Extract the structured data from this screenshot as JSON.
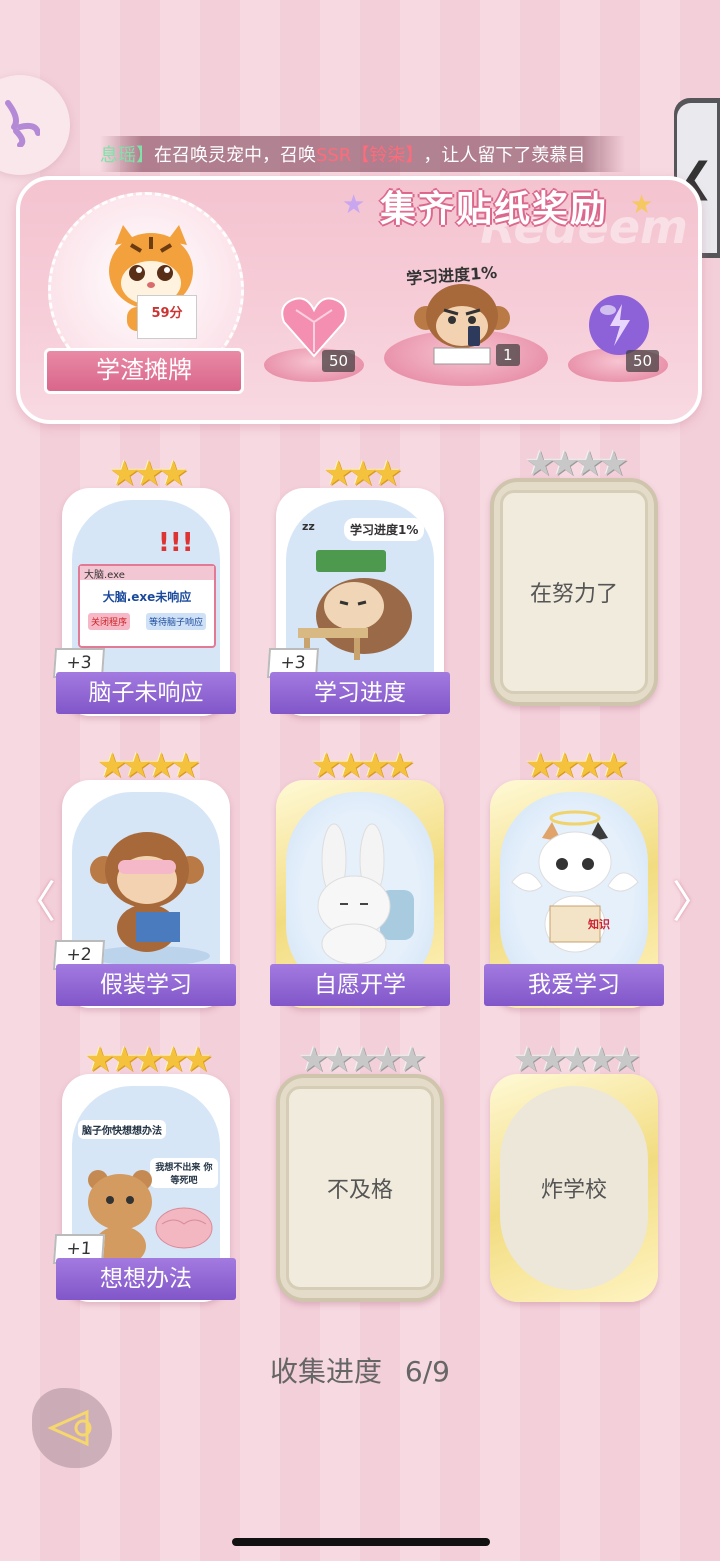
{
  "marquee": {
    "prefix": "息瑶】",
    "mid1": "在召唤灵宠中，召唤",
    "ssr": "SSR【铃柒】",
    "mid2": "，让人留下了羡慕目"
  },
  "side_tab": {
    "icon": "chevron-left-icon",
    "glyph": "❮"
  },
  "banner": {
    "title": "集齐贴纸奖励",
    "watermark": "Redeem",
    "sticker_title": "学渣摊牌",
    "tiger_paper": "59分",
    "progress_label": "学习进度1%",
    "rewards": [
      {
        "name": "pink-heart-gem-icon",
        "count": "50"
      },
      {
        "name": "monkey-study-sticker",
        "count": "1"
      },
      {
        "name": "purple-orb-icon",
        "count": "50"
      }
    ]
  },
  "cards": [
    {
      "title": "脑子未响应",
      "stars": 3,
      "max": 3,
      "plus": "+3",
      "locked": false,
      "art_text": [
        "大脑.exe",
        "大脑.exe未响应",
        "关闭程序",
        "等待脑子响应"
      ]
    },
    {
      "title": "学习进度",
      "stars": 3,
      "max": 3,
      "plus": "+3",
      "locked": false,
      "art_text": [
        "学习进度1%",
        "zz"
      ]
    },
    {
      "title": "在努力了",
      "stars": 0,
      "max": 4,
      "plus": "",
      "locked": true
    },
    {
      "title": "假装学习",
      "stars": 4,
      "max": 4,
      "plus": "+2",
      "locked": false
    },
    {
      "title": "自愿开学",
      "stars": 4,
      "max": 4,
      "plus": "",
      "locked": false
    },
    {
      "title": "我爱学习",
      "stars": 4,
      "max": 4,
      "plus": "",
      "locked": false,
      "art_text": [
        "知识"
      ]
    },
    {
      "title": "想想办法",
      "stars": 5,
      "max": 5,
      "plus": "+1",
      "locked": false,
      "art_text": [
        "脑子你快想想办法",
        "我想不出来 你等死吧"
      ]
    },
    {
      "title": "不及格",
      "stars": 0,
      "max": 5,
      "plus": "",
      "locked": true
    },
    {
      "title": "炸学校",
      "stars": 0,
      "max": 5,
      "plus": "",
      "locked": true
    }
  ],
  "nav": {
    "left": "〈",
    "right": "〉"
  },
  "collection": {
    "label": "收集进度",
    "value": "6/9"
  },
  "colors": {
    "ribbon": "#8f63d4",
    "banner": "#f4c3d0",
    "star_gold": "#f5c23d",
    "star_silver": "#c8c8c8"
  }
}
